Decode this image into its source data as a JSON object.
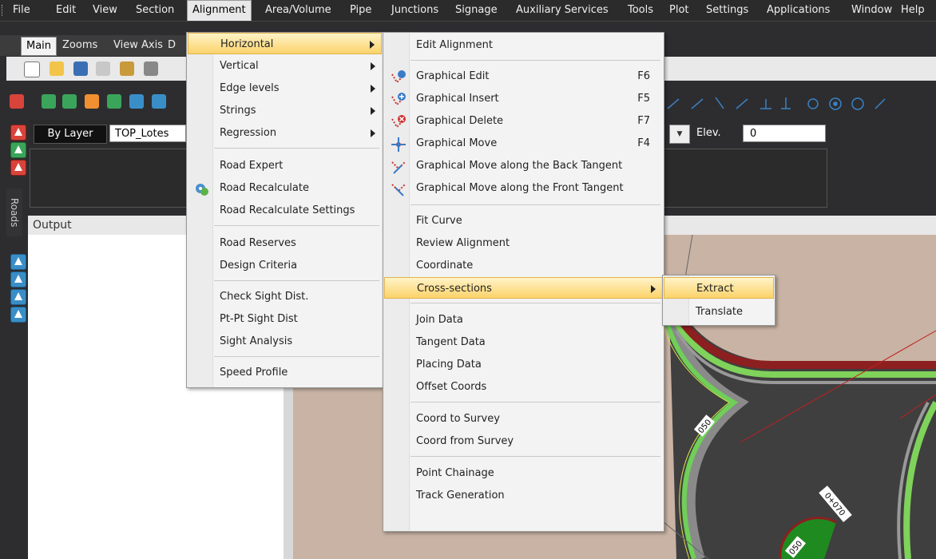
{
  "menubar": {
    "items": [
      "File",
      "Edit",
      "View",
      "Section",
      "Alignment",
      "Area/Volume",
      "Pipe",
      "Junctions",
      "Signage",
      "Auxiliary Services",
      "Tools",
      "Plot",
      "Settings",
      "Applications",
      "Window",
      "Help"
    ],
    "active": "Alignment"
  },
  "tabs": [
    "Main",
    "Zooms",
    "View Axis",
    "D"
  ],
  "layer": {
    "by_layer_label": "By Layer",
    "layer_value": "TOP_Lotes",
    "elev_label": "Elev.",
    "elev_value": "0"
  },
  "left_dock": {
    "roads_label": "Roads"
  },
  "output": {
    "title": "Output"
  },
  "alignment_menu": {
    "items": [
      {
        "label": "Horizontal",
        "submenu": true,
        "highlighted": true
      },
      {
        "label": "Vertical",
        "submenu": true
      },
      {
        "label": "Edge levels",
        "submenu": true
      },
      {
        "label": "Strings",
        "submenu": true
      },
      {
        "label": "Regression",
        "submenu": true
      },
      {
        "label": "Road Expert"
      },
      {
        "label": "Road Recalculate",
        "icon": "recalculate-icon"
      },
      {
        "label": "Road Recalculate Settings"
      },
      {
        "label": "Road Reserves"
      },
      {
        "label": "Design Criteria"
      },
      {
        "label": "Check Sight Dist."
      },
      {
        "label": "Pt-Pt Sight Dist"
      },
      {
        "label": "Sight Analysis"
      },
      {
        "label": "Speed Profile"
      }
    ]
  },
  "horizontal_menu": {
    "items": [
      {
        "label": "Edit Alignment"
      },
      {
        "label": "Graphical Edit",
        "shortcut": "F6",
        "icon": "graphical-edit-icon"
      },
      {
        "label": "Graphical Insert",
        "shortcut": "F5",
        "icon": "graphical-insert-icon"
      },
      {
        "label": "Graphical Delete",
        "shortcut": "F7",
        "icon": "graphical-delete-icon"
      },
      {
        "label": "Graphical Move",
        "shortcut": "F4",
        "icon": "graphical-move-icon"
      },
      {
        "label": "Graphical Move along the Back Tangent",
        "icon": "move-back-tangent-icon"
      },
      {
        "label": "Graphical Move along the Front Tangent",
        "icon": "move-front-tangent-icon"
      },
      {
        "label": "Fit Curve"
      },
      {
        "label": "Review Alignment"
      },
      {
        "label": "Coordinate"
      },
      {
        "label": "Cross-sections",
        "submenu": true,
        "highlighted": true
      },
      {
        "label": "Join Data"
      },
      {
        "label": "Tangent Data"
      },
      {
        "label": "Placing Data"
      },
      {
        "label": "Offset Coords"
      },
      {
        "label": "Coord to Survey"
      },
      {
        "label": "Coord from Survey"
      },
      {
        "label": "Point Chainage"
      },
      {
        "label": "Track Generation"
      }
    ]
  },
  "cross_sections_menu": {
    "items": [
      {
        "label": "Extract",
        "highlighted": true
      },
      {
        "label": "Translate"
      }
    ]
  },
  "canvas_labels": [
    "0+070",
    "050",
    "050"
  ]
}
